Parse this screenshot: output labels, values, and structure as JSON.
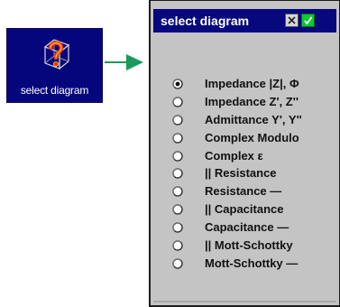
{
  "launcher": {
    "label": "select diagram",
    "icon": "question-box-icon",
    "background": "#06067c"
  },
  "arrow": {
    "icon": "right-arrow-icon",
    "color": "#1a9a5a"
  },
  "dialog": {
    "title": "select diagram",
    "titlebar_color": "#07077e",
    "close_icon": "close-x-icon",
    "ok_icon": "checkmark-icon",
    "selected_index": 0,
    "options": [
      {
        "label": "Impedance |Z|, Φ",
        "selected": true
      },
      {
        "label": "Impedance Z', Z''",
        "selected": false
      },
      {
        "label": "Admittance Y', Y''",
        "selected": false
      },
      {
        "label": "Complex Modulo",
        "selected": false
      },
      {
        "label": "Complex ε",
        "selected": false
      },
      {
        "label": "|| Resistance",
        "selected": false
      },
      {
        "label": "Resistance —",
        "selected": false
      },
      {
        "label": "|| Capacitance",
        "selected": false
      },
      {
        "label": "Capacitance —",
        "selected": false
      },
      {
        "label": "|| Mott-Schottky",
        "selected": false
      },
      {
        "label": "Mott-Schottky —",
        "selected": false
      }
    ]
  }
}
